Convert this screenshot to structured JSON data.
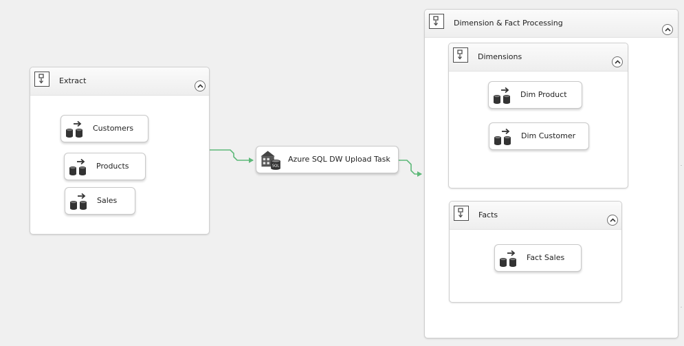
{
  "containers": {
    "extract": {
      "title": "Extract",
      "tasks": [
        {
          "label": "Customers"
        },
        {
          "label": "Products"
        },
        {
          "label": "Sales"
        }
      ]
    },
    "dimension_fact": {
      "title": "Dimension & Fact Processing",
      "dimensions": {
        "title": "Dimensions",
        "tasks": [
          {
            "label": "Dim Product"
          },
          {
            "label": "Dim Customer"
          }
        ]
      },
      "facts": {
        "title": "Facts",
        "tasks": [
          {
            "label": "Fact Sales"
          }
        ]
      }
    }
  },
  "upload_task": {
    "label": "Azure SQL DW Upload Task",
    "icon": "azure-sql-upload-icon"
  },
  "icons": {
    "container": "sequence-container-icon",
    "task": "data-flow-task-icon",
    "collapse": "collapse-chevron-icon"
  },
  "colors": {
    "canvas": "#f0f0f0",
    "precedence_constraint": "#5cb878",
    "container_border": "#cfcfcf"
  }
}
